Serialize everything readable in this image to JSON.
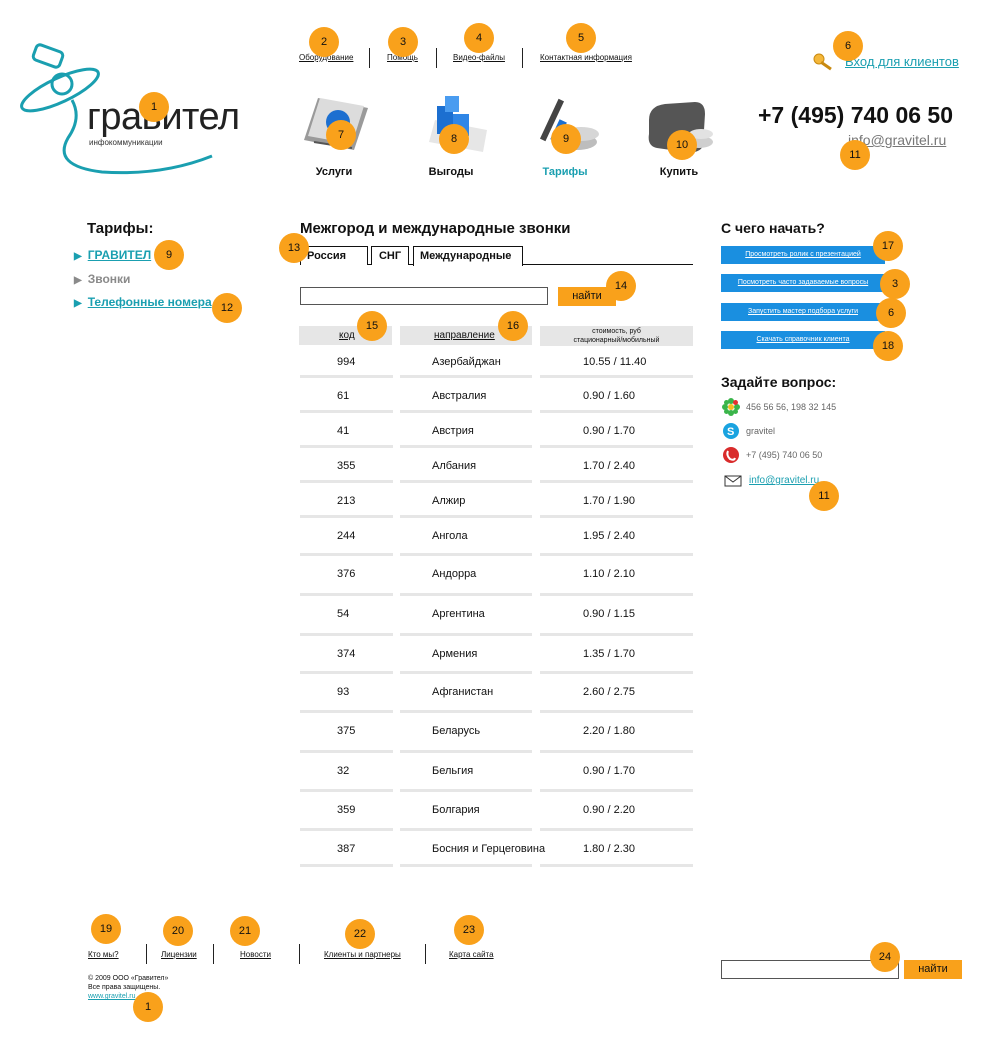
{
  "header": {
    "logo": {
      "brand": "гравител",
      "tagline": "инфокоммуникации"
    },
    "top_links": [
      {
        "label": "Оборудование"
      },
      {
        "label": "Помощь"
      },
      {
        "label": "Видео-файлы"
      },
      {
        "label": "Контактная информация"
      }
    ],
    "login_label": "Вход для клиентов",
    "phone": "+7 (495) 740 06 50",
    "email": "info@gravitel.ru",
    "nav": [
      {
        "label": "Услуги",
        "icon": "book-icon",
        "active": false
      },
      {
        "label": "Выгоды",
        "icon": "cubes-icon",
        "active": false
      },
      {
        "label": "Тарифы",
        "icon": "tools-coins-icon",
        "active": true
      },
      {
        "label": "Купить",
        "icon": "wallet-coins-icon",
        "active": false
      }
    ]
  },
  "sidebar": {
    "title": "Тарифы:",
    "items": [
      {
        "label": "ГРАВИТЕЛ",
        "active": true
      },
      {
        "label": "Звонки",
        "active": false
      },
      {
        "label": "Телефонные номера",
        "active": true
      }
    ]
  },
  "main": {
    "title": "Межгород и международные звонки",
    "tabs": [
      "Россия",
      "СНГ",
      "Международные"
    ],
    "active_tab": "Международные",
    "search": {
      "value": "",
      "button": "найти"
    },
    "table": {
      "headers": {
        "code": "код",
        "direction": "направление",
        "cost_line1": "стоимость, руб",
        "cost_line2": "стационарный/мобильный"
      },
      "rows": [
        {
          "code": "994",
          "direction": "Азербайджан",
          "cost": "10.55 / 11.40"
        },
        {
          "code": "61",
          "direction": "Австралия",
          "cost": "0.90 / 1.60"
        },
        {
          "code": "41",
          "direction": "Австрия",
          "cost": "0.90 / 1.70"
        },
        {
          "code": "355",
          "direction": "Албания",
          "cost": "1.70 / 2.40"
        },
        {
          "code": "213",
          "direction": "Алжир",
          "cost": "1.70 / 1.90"
        },
        {
          "code": "244",
          "direction": "Ангола",
          "cost": "1.95 / 2.40"
        },
        {
          "code": "376",
          "direction": "Андорра",
          "cost": "1.10 / 2.10"
        },
        {
          "code": "54",
          "direction": "Аргентина",
          "cost": "0.90 / 1.15"
        },
        {
          "code": "374",
          "direction": "Армения",
          "cost": "1.35 / 1.70"
        },
        {
          "code": "93",
          "direction": "Афганистан",
          "cost": "2.60 / 2.75"
        },
        {
          "code": "375",
          "direction": "Беларусь",
          "cost": "2.20 / 1.80"
        },
        {
          "code": "32",
          "direction": "Бельгия",
          "cost": "0.90 / 1.70"
        },
        {
          "code": "359",
          "direction": "Болгария",
          "cost": "0.90 / 2.20"
        },
        {
          "code": "387",
          "direction": "Босния и Герцеговина",
          "cost": "1.80 / 2.30"
        }
      ]
    }
  },
  "right": {
    "start_title": "С чего начать?",
    "start_buttons": [
      "Просмотреть ролик с презентацией",
      "Посмотреть часто задаваемые вопросы",
      "Запустить мастер подбора услуги",
      "Скачать справочник клиента"
    ],
    "ask_title": "Задайте вопрос:",
    "contacts": {
      "icq": "456 56 56, 198 32 145",
      "skype": "gravitel",
      "phone": "+7 (495) 740 06 50",
      "email": "info@gravitel.ru"
    }
  },
  "footer": {
    "links": [
      "Кто мы?",
      "Лицензии",
      "Новости",
      "Клиенты и партнеры",
      "Карта сайта"
    ],
    "copyright": "© 2009 ООО «Гравител»",
    "rights": "Все права защищены.",
    "site": "www.gravitel.ru",
    "search": {
      "value": "",
      "button": "найти"
    }
  },
  "badges": [
    "1",
    "2",
    "3",
    "4",
    "5",
    "6",
    "7",
    "8",
    "9",
    "10",
    "11",
    "9",
    "12",
    "13",
    "14",
    "15",
    "16",
    "17",
    "3",
    "6",
    "18",
    "11",
    "19",
    "20",
    "21",
    "22",
    "23",
    "24",
    "1"
  ],
  "colors": {
    "accent": "#1a9fb0",
    "badge": "#f9a11b",
    "button_blue": "#1a8fe0",
    "button_orange": "#f9a11b"
  }
}
